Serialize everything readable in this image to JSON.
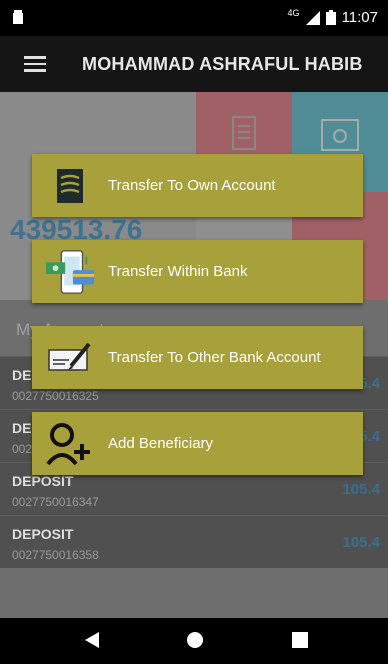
{
  "status": {
    "time": "11:07",
    "network": "4G"
  },
  "appbar": {
    "title": "MOHAMMAD ASHRAFUL HABIB"
  },
  "dashboard": {
    "balance": "439513.76",
    "accounts_label": "My Accounts",
    "accounts": [
      {
        "type": "DEPOSIT",
        "number": "0027750016325",
        "amount": "105.4"
      },
      {
        "type": "DEPOSIT",
        "number": "0027750016336",
        "amount": "105.4"
      },
      {
        "type": "DEPOSIT",
        "number": "0027750016347",
        "amount": "105.4"
      },
      {
        "type": "DEPOSIT",
        "number": "0027750016358",
        "amount": "105.4"
      }
    ]
  },
  "actions": [
    {
      "label": "Transfer To Own Account",
      "icon": "ledger-icon"
    },
    {
      "label": "Transfer Within Bank",
      "icon": "phone-card-icon"
    },
    {
      "label": "Transfer To Other Bank Account",
      "icon": "cheque-pen-icon"
    },
    {
      "label": "Add Beneficiary",
      "icon": "add-user-icon"
    }
  ],
  "colors": {
    "action_bg": "#a8a03a",
    "amount_blue": "#3a6e8d",
    "tile_red": "#a06066"
  }
}
